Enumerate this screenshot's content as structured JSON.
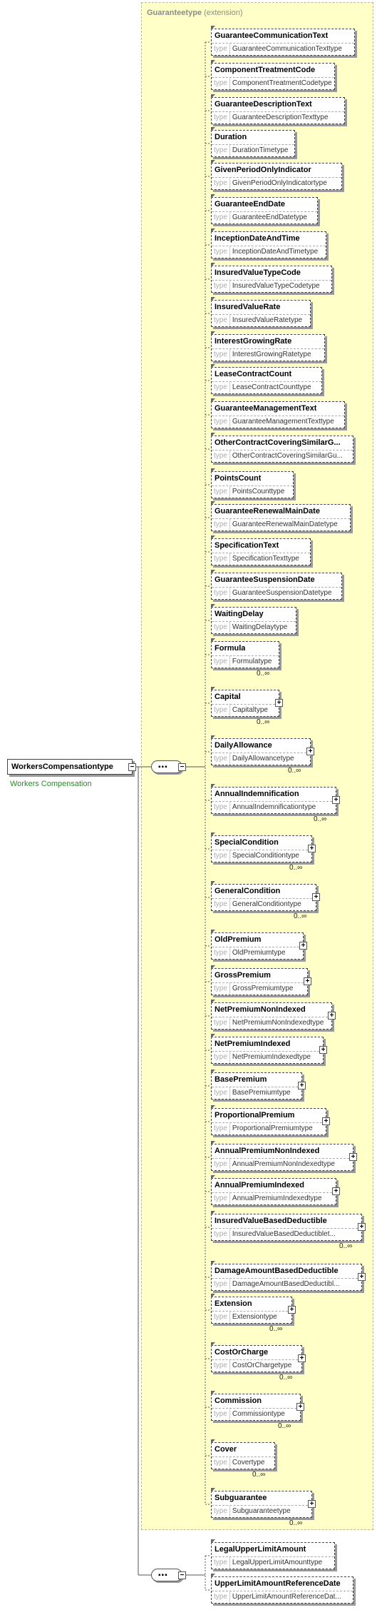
{
  "root": {
    "name": "WorkersCompensationtype",
    "documentation": "Workers Compensation"
  },
  "extension": {
    "base": "Guaranteetype",
    "kind": "(extension)"
  },
  "type_label": "type",
  "elements": [
    {
      "name": "GuaranteeCommunicationText",
      "type": "GuaranteeCommunicationTexttype",
      "occurs": "",
      "optional": true,
      "expandable": false
    },
    {
      "name": "ComponentTreatmentCode",
      "type": "ComponentTreatmentCodetype",
      "occurs": "",
      "optional": true,
      "expandable": false
    },
    {
      "name": "GuaranteeDescriptionText",
      "type": "GuaranteeDescriptionTexttype",
      "occurs": "",
      "optional": true,
      "expandable": false
    },
    {
      "name": "Duration",
      "type": "DurationTimetype",
      "occurs": "",
      "optional": true,
      "expandable": false
    },
    {
      "name": "GivenPeriodOnlyIndicator",
      "type": "GivenPeriodOnlyIndicatortype",
      "occurs": "",
      "optional": true,
      "expandable": false
    },
    {
      "name": "GuaranteeEndDate",
      "type": "GuaranteeEndDatetype",
      "occurs": "",
      "optional": true,
      "expandable": false
    },
    {
      "name": "InceptionDateAndTime",
      "type": "InceptionDateAndTimetype",
      "occurs": "",
      "optional": true,
      "expandable": false
    },
    {
      "name": "InsuredValueTypeCode",
      "type": "InsuredValueTypeCodetype",
      "occurs": "",
      "optional": true,
      "expandable": false
    },
    {
      "name": "InsuredValueRate",
      "type": "InsuredValueRatetype",
      "occurs": "",
      "optional": true,
      "expandable": false
    },
    {
      "name": "InterestGrowingRate",
      "type": "InterestGrowingRatetype",
      "occurs": "",
      "optional": true,
      "expandable": false
    },
    {
      "name": "LeaseContractCount",
      "type": "LeaseContractCounttype",
      "occurs": "",
      "optional": true,
      "expandable": false
    },
    {
      "name": "GuaranteeManagementText",
      "type": "GuaranteeManagementTexttype",
      "occurs": "",
      "optional": true,
      "expandable": false
    },
    {
      "name": "OtherContractCoveringSimilarG...",
      "type": "OtherContractCoveringSimilarGu...",
      "occurs": "",
      "optional": true,
      "expandable": false
    },
    {
      "name": "PointsCount",
      "type": "PointsCounttype",
      "occurs": "",
      "optional": true,
      "expandable": false
    },
    {
      "name": "GuaranteeRenewalMainDate",
      "type": "GuaranteeRenewalMainDatetype",
      "occurs": "",
      "optional": true,
      "expandable": false
    },
    {
      "name": "SpecificationText",
      "type": "SpecificationTexttype",
      "occurs": "",
      "optional": true,
      "expandable": false
    },
    {
      "name": "GuaranteeSuspensionDate",
      "type": "GuaranteeSuspensionDatetype",
      "occurs": "",
      "optional": true,
      "expandable": false
    },
    {
      "name": "WaitingDelay",
      "type": "WaitingDelaytype",
      "occurs": "",
      "optional": true,
      "expandable": false
    },
    {
      "name": "Formula",
      "type": "Formulatype",
      "occurs": "0..∞",
      "optional": true,
      "expandable": false
    },
    {
      "name": "Capital",
      "type": "Capitaltype",
      "occurs": "0..∞",
      "optional": true,
      "expandable": true
    },
    {
      "name": "DailyAllowance",
      "type": "DailyAllowancetype",
      "occurs": "0..∞",
      "optional": true,
      "expandable": true
    },
    {
      "name": "AnnualIndemnification",
      "type": "AnnualIndemnificationtype",
      "occurs": "0..∞",
      "optional": true,
      "expandable": true
    },
    {
      "name": "SpecialCondition",
      "type": "SpecialConditiontype",
      "occurs": "0..∞",
      "optional": true,
      "expandable": true
    },
    {
      "name": "GeneralCondition",
      "type": "GeneralConditiontype",
      "occurs": "0..∞",
      "optional": true,
      "expandable": true
    },
    {
      "name": "OldPremium",
      "type": "OldPremiumtype",
      "occurs": "",
      "optional": true,
      "expandable": true
    },
    {
      "name": "GrossPremium",
      "type": "GrossPremiumtype",
      "occurs": "",
      "optional": true,
      "expandable": true
    },
    {
      "name": "NetPremiumNonIndexed",
      "type": "NetPremiumNonIndexedtype",
      "occurs": "",
      "optional": true,
      "expandable": true
    },
    {
      "name": "NetPremiumIndexed",
      "type": "NetPremiumIndexedtype",
      "occurs": "",
      "optional": true,
      "expandable": true
    },
    {
      "name": "BasePremium",
      "type": "BasePremiumtype",
      "occurs": "",
      "optional": true,
      "expandable": true
    },
    {
      "name": "ProportionalPremium",
      "type": "ProportionalPremiumtype",
      "occurs": "",
      "optional": true,
      "expandable": true
    },
    {
      "name": "AnnualPremiumNonIndexed",
      "type": "AnnualPremiumNonIndexedtype",
      "occurs": "",
      "optional": true,
      "expandable": true
    },
    {
      "name": "AnnualPremiumIndexed",
      "type": "AnnualPremiumIndexedtype",
      "occurs": "",
      "optional": true,
      "expandable": true
    },
    {
      "name": "InsuredValueBasedDeductible",
      "type": "InsuredValueBasedDeductiblet...",
      "occurs": "0..∞",
      "optional": true,
      "expandable": true
    },
    {
      "name": "DamageAmountBasedDeductible",
      "type": "DamageAmountBasedDeductibl...",
      "occurs": "",
      "optional": true,
      "expandable": true
    },
    {
      "name": "Extension",
      "type": "Extensiontype",
      "occurs": "0..∞",
      "optional": true,
      "expandable": true
    },
    {
      "name": "CostOrCharge",
      "type": "CostOrChargetype",
      "occurs": "0..∞",
      "optional": true,
      "expandable": true
    },
    {
      "name": "Commission",
      "type": "Commissiontype",
      "occurs": "0..∞",
      "optional": true,
      "expandable": true
    },
    {
      "name": "Cover",
      "type": "Covertype",
      "occurs": "0..∞",
      "optional": true,
      "expandable": false
    },
    {
      "name": "Subguarantee",
      "type": "Subguaranteetype",
      "occurs": "0..∞",
      "optional": true,
      "expandable": true
    }
  ],
  "second_sequence": [
    {
      "name": "LegalUpperLimitAmount",
      "type": "LegalUpperLimitAmounttype",
      "occurs": "",
      "optional": true,
      "expandable": false
    },
    {
      "name": "UpperLimitAmountReferenceDate",
      "type": "UpperLimitAmountReferenceDat...",
      "occurs": "",
      "optional": true,
      "expandable": false
    }
  ],
  "colors": {
    "extension_bg": "#ffffc8",
    "documentation": "#2a8a2a"
  }
}
